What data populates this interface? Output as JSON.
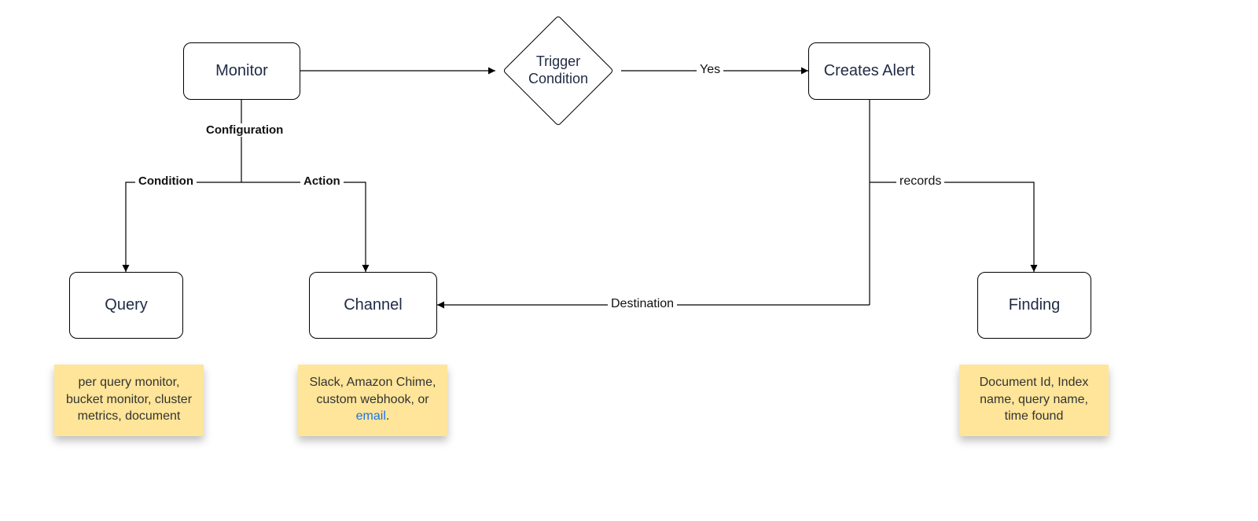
{
  "nodes": {
    "monitor": {
      "label": "Monitor"
    },
    "trigger": {
      "label": "Trigger\nCondition"
    },
    "creates_alert": {
      "label": "Creates Alert"
    },
    "query": {
      "label": "Query"
    },
    "channel": {
      "label": "Channel"
    },
    "finding": {
      "label": "Finding"
    }
  },
  "edges": {
    "monitor_config": {
      "label": "Configuration"
    },
    "config_condition": {
      "label": "Condition"
    },
    "config_action": {
      "label": "Action"
    },
    "trigger_yes": {
      "label": "Yes"
    },
    "alert_records": {
      "label": "records"
    },
    "alert_destination": {
      "label": "Destination"
    }
  },
  "notes": {
    "query": {
      "text": "per query monitor, bucket monitor, cluster metrics, document"
    },
    "channel": {
      "before": "Slack, Amazon Chime, custom webhook, or ",
      "link": "email",
      "after": "."
    },
    "finding": {
      "text": "Document Id, Index name, query name, time found"
    }
  }
}
